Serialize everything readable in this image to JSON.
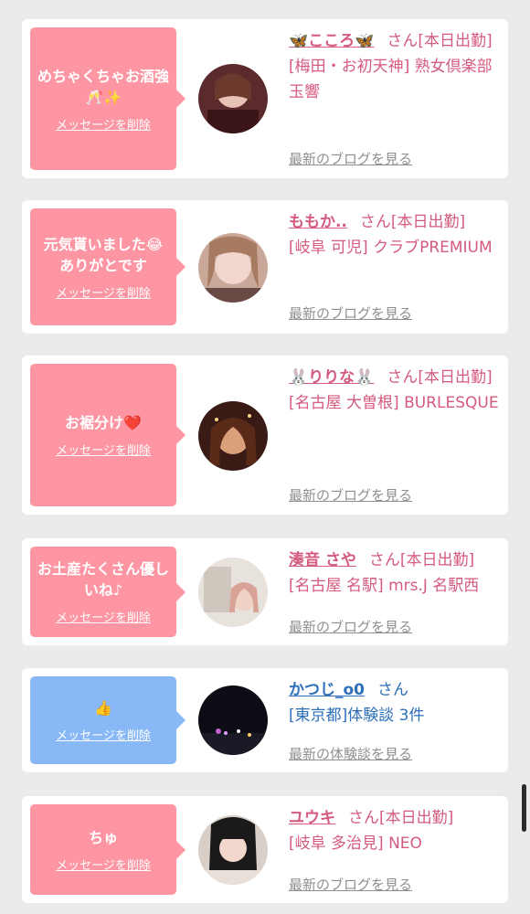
{
  "delete_label": "メッセージを削除",
  "san_label": "さん",
  "cards": [
    {
      "message": "めちゃくちゃお酒強🥂✨",
      "name": "🦋こころ🦋",
      "status": "[本日出勤]",
      "shop": "[梅田・お初天神] 熟女倶楽部 玉響",
      "link": "最新のブログを見る",
      "color": "#fe95a3"
    },
    {
      "message": "元気貰いました😂ありがとです",
      "name": "ももか..",
      "status": "[本日出勤]",
      "shop": "[岐阜 可児] クラブPREMIUM",
      "link": "最新のブログを見る",
      "color": "#fe95a3"
    },
    {
      "message": "お裾分け❤️",
      "name": "🐰りりな🐰",
      "status": "[本日出勤]",
      "shop": "[名古屋 大曽根] BURLESQUE",
      "link": "最新のブログを見る",
      "color": "#fe95a3"
    },
    {
      "message": "お土産たくさん優しいね♪",
      "name": "湊音 さや",
      "status": "[本日出勤]",
      "shop": "[名古屋 名駅] mrs.J 名駅西",
      "link": "最新のブログを見る",
      "color": "#fe95a3"
    },
    {
      "message": "👍",
      "name": "かつじ_o0",
      "status": "",
      "shop": "[東京都]体験談 3件",
      "link": "最新の体験談を見る",
      "color": "#88b8f6"
    },
    {
      "message": "ちゅ",
      "name": "ユウキ",
      "status": "[本日出勤]",
      "shop": "[岐阜 多治見] NEO",
      "link": "最新のブログを見る",
      "color": "#fe95a3"
    }
  ]
}
